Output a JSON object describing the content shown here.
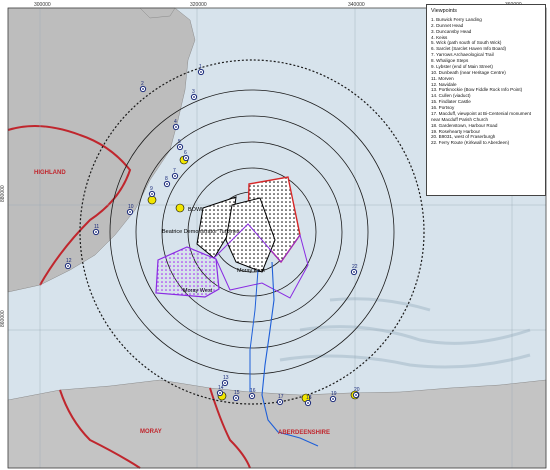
{
  "grid_labels": {
    "top": [
      "300000",
      "320000",
      "340000",
      "360000"
    ],
    "left": [
      "880000",
      "860000"
    ]
  },
  "place_names": {
    "highland": "HIGHLAND",
    "moray": "MORAY",
    "aberdeenshire": "ABERDEENSHIRE"
  },
  "wind_farms": {
    "boWL": "BOWL",
    "beatrice": "Beatrice Demonstrator Turbines",
    "moray_east": "Moray East",
    "moray_west": "Moray West"
  },
  "legend": {
    "title": "Viewpoints",
    "items": [
      "1. Burwick Ferry Landing",
      "2. Dunnet Head",
      "3. Duncansby Head",
      "4. Keiss",
      "5. Wick (path south of South Wick)",
      "6. Sarclet (Sarclet Haven Info Board)",
      "7. Yarrows Archaeological Trail",
      "8. Whaligoe Steps",
      "9. Lybster (end of Main Street)",
      "10. Dunbeath (near Heritage Centre)",
      "11. Morven",
      "12. Navidale",
      "13. Portknockie (Bow Fiddle Rock Info Point)",
      "14. Cullen (viaduct)",
      "15. Findlater Castle",
      "16. Portsoy",
      "17. Macduff, viewpoint at Bi-Centenial monument near Macduff Parish Church",
      "18. Gardenstown, Harbour Road",
      "19. Rosehearty Harbour",
      "20. B9031, west of Fraserburgh",
      "22. Ferry Route (Kirkwall to Aberdeen)"
    ]
  },
  "viewpoint_markers": [
    "1",
    "2",
    "3",
    "4",
    "5",
    "6",
    "7",
    "8",
    "9",
    "10",
    "11",
    "12",
    "13",
    "14",
    "15",
    "16",
    "17",
    "18",
    "19",
    "20",
    "22"
  ],
  "colors": {
    "sea": "#d7e3ec",
    "land": "#b9b9b9",
    "rings": "#1a1a1a",
    "study_area": "#000000",
    "moray_east": "#d62728",
    "moray_west": "#8a2be2",
    "cable": "#1e5fd8",
    "council_boundary": "#c0262d",
    "viewpoint": "#1a2a7a",
    "highlight": "#f2e600"
  }
}
